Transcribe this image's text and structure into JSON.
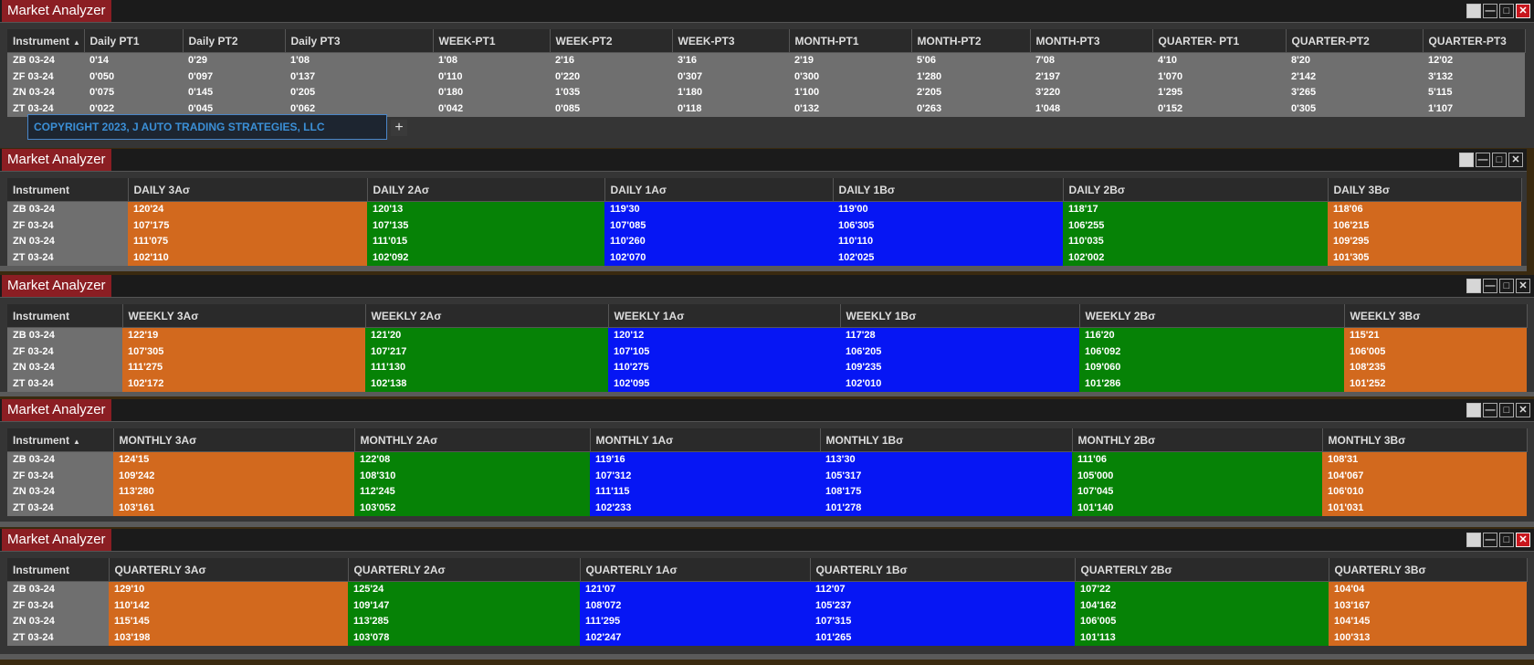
{
  "colors": {
    "orange": "#d2691e",
    "green": "#068206",
    "blue": "#0616f4",
    "title_tab": "#8b1e23",
    "close": "#c8161d"
  },
  "icons": {
    "minimize": "minimize-icon",
    "maximize": "maximize-icon",
    "close": "close-icon",
    "restore": "restore-icon"
  },
  "copyright": "COPYRIGHT 2023, J AUTO TRADING STRATEGIES, LLC",
  "add_tab": "+",
  "sort_indicator": "▲",
  "window_buttons": {
    "minimize": "—",
    "maximize": "□",
    "close": "✕"
  },
  "windows": [
    {
      "title": "Market Analyzer",
      "headers": [
        "Instrument",
        "Daily PT1",
        "Daily PT2",
        "Daily PT3",
        "WEEK-PT1",
        "WEEK-PT2",
        "WEEK-PT3",
        "MONTH-PT1",
        "MONTH-PT2",
        "MONTH-PT3",
        "QUARTER- PT1",
        "QUARTER-PT2",
        "QUARTER-PT3"
      ],
      "rows": [
        [
          "ZB 03-24",
          "0'14",
          "0'29",
          "1'08",
          "1'08",
          "2'16",
          "3'16",
          "2'19",
          "5'06",
          "7'08",
          "4'10",
          "8'20",
          "12'02"
        ],
        [
          "ZF 03-24",
          "0'050",
          "0'097",
          "0'137",
          "0'110",
          "0'220",
          "0'307",
          "0'300",
          "1'280",
          "2'197",
          "1'070",
          "2'142",
          "3'132"
        ],
        [
          "ZN 03-24",
          "0'075",
          "0'145",
          "0'205",
          "0'180",
          "1'035",
          "1'180",
          "1'100",
          "2'205",
          "3'220",
          "1'295",
          "3'265",
          "5'115"
        ],
        [
          "ZT 03-24",
          "0'022",
          "0'045",
          "0'062",
          "0'042",
          "0'085",
          "0'118",
          "0'132",
          "0'263",
          "1'048",
          "0'152",
          "0'305",
          "1'107"
        ]
      ]
    },
    {
      "title": "Market Analyzer",
      "headers": [
        "Instrument",
        "DAILY 3Aσ",
        "DAILY 2Aσ",
        "DAILY 1Aσ",
        "DAILY 1Bσ",
        "DAILY 2Bσ",
        "DAILY 3Bσ"
      ],
      "rows": [
        [
          "ZB 03-24",
          "120'24",
          "120'13",
          "119'30",
          "119'00",
          "118'17",
          "118'06"
        ],
        [
          "ZF 03-24",
          "107'175",
          "107'135",
          "107'085",
          "106'305",
          "106'255",
          "106'215"
        ],
        [
          "ZN 03-24",
          "111'075",
          "111'015",
          "110'260",
          "110'110",
          "110'035",
          "109'295"
        ],
        [
          "ZT 03-24",
          "102'110",
          "102'092",
          "102'070",
          "102'025",
          "102'002",
          "101'305"
        ]
      ]
    },
    {
      "title": "Market Analyzer",
      "headers": [
        "Instrument",
        "WEEKLY 3Aσ",
        "WEEKLY 2Aσ",
        "WEEKLY 1Aσ",
        "WEEKLY 1Bσ",
        "WEEKLY 2Bσ",
        "WEEKLY 3Bσ"
      ],
      "rows": [
        [
          "ZB 03-24",
          "122'19",
          "121'20",
          "120'12",
          "117'28",
          "116'20",
          "115'21"
        ],
        [
          "ZF 03-24",
          "107'305",
          "107'217",
          "107'105",
          "106'205",
          "106'092",
          "106'005"
        ],
        [
          "ZN 03-24",
          "111'275",
          "111'130",
          "110'275",
          "109'235",
          "109'060",
          "108'235"
        ],
        [
          "ZT 03-24",
          "102'172",
          "102'138",
          "102'095",
          "102'010",
          "101'286",
          "101'252"
        ]
      ]
    },
    {
      "title": "Market Analyzer",
      "headers": [
        "Instrument",
        "MONTHLY 3Aσ",
        "MONTHLY 2Aσ",
        "MONTHLY 1Aσ",
        "MONTHLY 1Bσ",
        "MONTHLY 2Bσ",
        "MONTHLY 3Bσ"
      ],
      "rows": [
        [
          "ZB 03-24",
          "124'15",
          "122'08",
          "119'16",
          "113'30",
          "111'06",
          "108'31"
        ],
        [
          "ZF 03-24",
          "109'242",
          "108'310",
          "107'312",
          "105'317",
          "105'000",
          "104'067"
        ],
        [
          "ZN 03-24",
          "113'280",
          "112'245",
          "111'115",
          "108'175",
          "107'045",
          "106'010"
        ],
        [
          "ZT 03-24",
          "103'161",
          "103'052",
          "102'233",
          "101'278",
          "101'140",
          "101'031"
        ]
      ]
    },
    {
      "title": "Market Analyzer",
      "headers": [
        "Instrument",
        "QUARTERLY 3Aσ",
        "QUARTERLY 2Aσ",
        "QUARTERLY 1Aσ",
        "QUARTERLY 1Bσ",
        "QUARTERLY 2Bσ",
        "QUARTERLY 3Bσ"
      ],
      "rows": [
        [
          "ZB 03-24",
          "129'10",
          "125'24",
          "121'07",
          "112'07",
          "107'22",
          "104'04"
        ],
        [
          "ZF 03-24",
          "110'142",
          "109'147",
          "108'072",
          "105'237",
          "104'162",
          "103'167"
        ],
        [
          "ZN 03-24",
          "115'145",
          "113'285",
          "111'295",
          "107'315",
          "106'005",
          "104'145"
        ],
        [
          "ZT 03-24",
          "103'198",
          "103'078",
          "102'247",
          "101'265",
          "101'113",
          "100'313"
        ]
      ]
    }
  ]
}
